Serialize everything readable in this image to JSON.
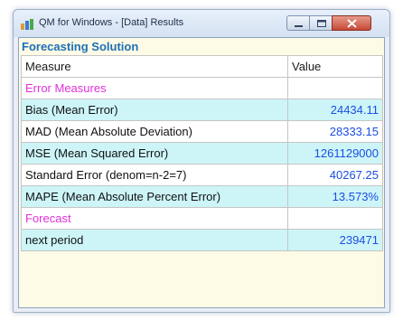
{
  "window": {
    "title": "QM for Windows - [Data] Results",
    "heading": "Forecasting Solution"
  },
  "table": {
    "headers": {
      "measure": "Measure",
      "value": "Value"
    },
    "rows": [
      {
        "measure": "Error Measures",
        "value": ""
      },
      {
        "measure": "Bias (Mean Error)",
        "value": "24434.11"
      },
      {
        "measure": "MAD (Mean Absolute Deviation)",
        "value": "28333.15"
      },
      {
        "measure": "MSE (Mean Squared Error)",
        "value": "1261129000"
      },
      {
        "measure": "Standard Error (denom=n-2=7)",
        "value": "40267.25"
      },
      {
        "measure": "MAPE (Mean Absolute Percent Error)",
        "value": "13.573%"
      },
      {
        "measure": "Forecast",
        "value": ""
      },
      {
        "measure": "next period",
        "value": "239471"
      }
    ]
  },
  "colors": {
    "section_label": "#e030d8",
    "value_text": "#1a4fe0",
    "highlight_row": "#cdf5f8",
    "panel_background": "#fdfae6"
  },
  "icons": {
    "app": "qm-app-icon",
    "minimize": "minimize-icon",
    "maximize": "maximize-icon",
    "close": "close-icon"
  }
}
